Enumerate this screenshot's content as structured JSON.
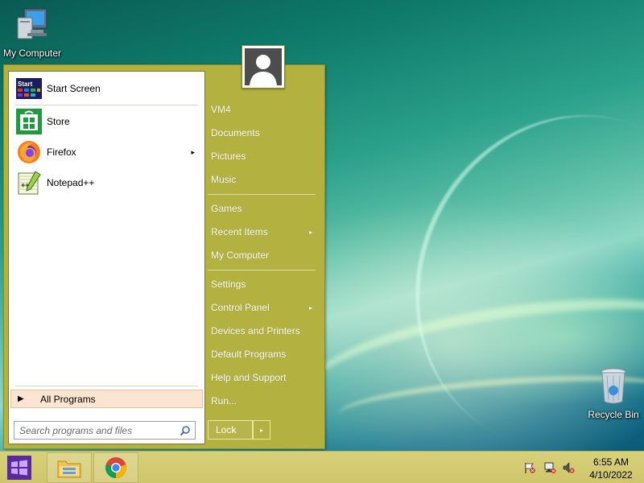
{
  "desktop": {
    "icons": [
      {
        "label": "My Computer",
        "icon": "computer-icon"
      },
      {
        "label": "Recycle Bin",
        "icon": "recycle-bin-icon"
      }
    ]
  },
  "start_menu": {
    "left_pane": {
      "programs": [
        {
          "label": "Start Screen",
          "icon": "start-screen-icon",
          "has_submenu": false
        },
        {
          "label": "Store",
          "icon": "store-icon",
          "has_submenu": false
        },
        {
          "label": "Firefox",
          "icon": "firefox-icon",
          "has_submenu": true
        },
        {
          "label": "Notepad++",
          "icon": "notepadpp-icon",
          "has_submenu": false
        }
      ],
      "start_tile_text": "Start",
      "all_programs": "All Programs",
      "search_placeholder": "Search programs and files"
    },
    "right_pane": {
      "items": [
        {
          "label": "VM4",
          "has_submenu": false
        },
        {
          "label": "Documents",
          "has_submenu": false
        },
        {
          "label": "Pictures",
          "has_submenu": false
        },
        {
          "label": "Music",
          "has_submenu": false
        },
        {
          "label": "Games",
          "has_submenu": false
        },
        {
          "label": "Recent Items",
          "has_submenu": true
        },
        {
          "label": "My Computer",
          "has_submenu": false
        },
        {
          "label": "Settings",
          "has_submenu": false
        },
        {
          "label": "Control Panel",
          "has_submenu": true
        },
        {
          "label": "Devices and Printers",
          "has_submenu": false
        },
        {
          "label": "Default Programs",
          "has_submenu": false
        },
        {
          "label": "Help and Support",
          "has_submenu": false
        },
        {
          "label": "Run...",
          "has_submenu": false
        }
      ],
      "lock_label": "Lock",
      "lock_arrow": "▸"
    },
    "submenu_arrow": "▸",
    "all_programs_arrow": "▶"
  },
  "taskbar": {
    "apps": [
      {
        "name": "File Explorer",
        "icon": "file-explorer-icon"
      },
      {
        "name": "Google Chrome",
        "icon": "chrome-icon"
      }
    ],
    "tray": [
      "action-center-flag-icon",
      "network-icon",
      "volume-muted-icon"
    ],
    "clock": {
      "time": "6:55 AM",
      "date": "4/10/2022"
    }
  },
  "colors": {
    "menu_bg": "#b3b13f",
    "taskbar_bg": "#d4cb72",
    "highlight": "#fbe5d0"
  }
}
